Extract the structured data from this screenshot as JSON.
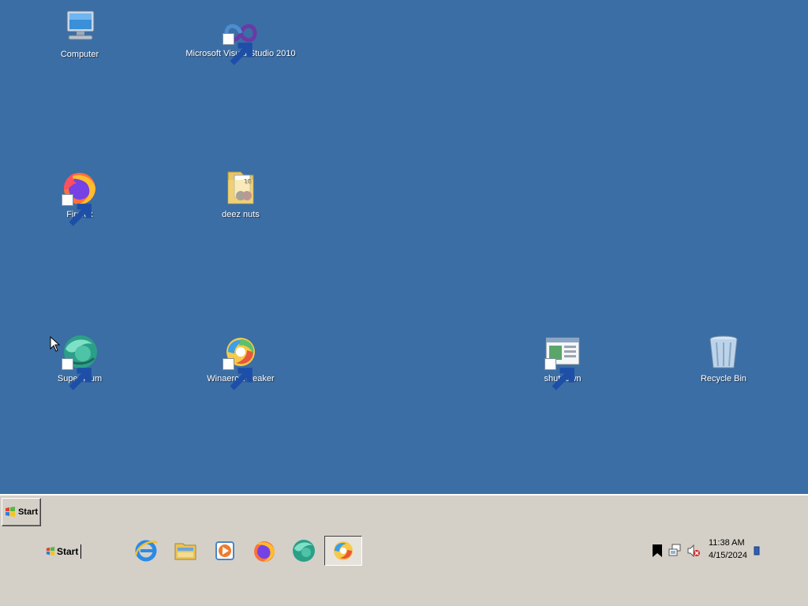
{
  "desktop": {
    "background_color": "#3b6ea5",
    "icons": [
      {
        "label": "Computer",
        "icon": "computer-icon"
      },
      {
        "label": "Microsoft Visual Studio 2010",
        "icon": "visual-studio-icon"
      },
      {
        "label": "Firefox",
        "icon": "firefox-icon"
      },
      {
        "label": "deez nuts",
        "icon": "folder-icon"
      },
      {
        "label": "Supermium",
        "icon": "supermium-icon"
      },
      {
        "label": "Winaero Tweaker",
        "icon": "winaero-tweaker-icon"
      },
      {
        "label": "shutdown",
        "icon": "shutdown-shortcut-icon"
      },
      {
        "label": "Recycle Bin",
        "icon": "recycle-bin-icon"
      }
    ]
  },
  "taskbar": {
    "start_label": "Start",
    "start_label_secondary": "Start",
    "pinned": [
      {
        "icon": "internet-explorer-icon"
      },
      {
        "icon": "file-explorer-icon"
      },
      {
        "icon": "media-player-icon"
      },
      {
        "icon": "firefox-icon"
      },
      {
        "icon": "supermium-icon"
      },
      {
        "icon": "winaero-tweaker-icon"
      }
    ],
    "tray": {
      "icons": [
        "bookmark-icon",
        "network-icon",
        "volume-muted-icon",
        "show-desktop-icon"
      ],
      "time": "11:38 AM",
      "date": "4/15/2024"
    }
  }
}
